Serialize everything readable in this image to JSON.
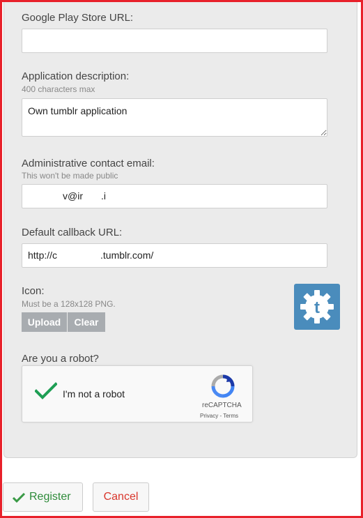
{
  "form": {
    "play_store_url": {
      "label": "Google Play Store URL:",
      "value": ""
    },
    "description": {
      "label": "Application description:",
      "hint": "400 characters max",
      "value": "Own tumblr application"
    },
    "contact_email": {
      "label": "Administrative contact email:",
      "hint": "This won't be made public",
      "value": "v@ir",
      "value_tail": ".i"
    },
    "callback_url": {
      "label": "Default callback URL:",
      "value_start": "http://c",
      "value_end": ".tumblr.com/"
    },
    "icon": {
      "label": "Icon:",
      "hint": "Must be a 128x128 PNG.",
      "upload_label": "Upload",
      "clear_label": "Clear",
      "glyph": "t"
    },
    "robot": {
      "label": "Are you a robot?",
      "checkbox_label": "I'm not a robot",
      "brand": "reCAPTCHA",
      "privacy": "Privacy",
      "separator": " - ",
      "terms": "Terms"
    }
  },
  "footer": {
    "register_label": "Register",
    "cancel_label": "Cancel"
  },
  "colors": {
    "frame": "#e8202a",
    "icon_bg": "#4a8cbc",
    "checkmark": "#1e9e54",
    "cancel_text": "#d9362c",
    "register_text": "#2e8b3a"
  },
  "icons": {
    "register": "check-icon",
    "recaptcha": "recaptcha-logo-icon",
    "app": "tumblr-gear-icon",
    "checkbox": "checkmark-icon"
  }
}
